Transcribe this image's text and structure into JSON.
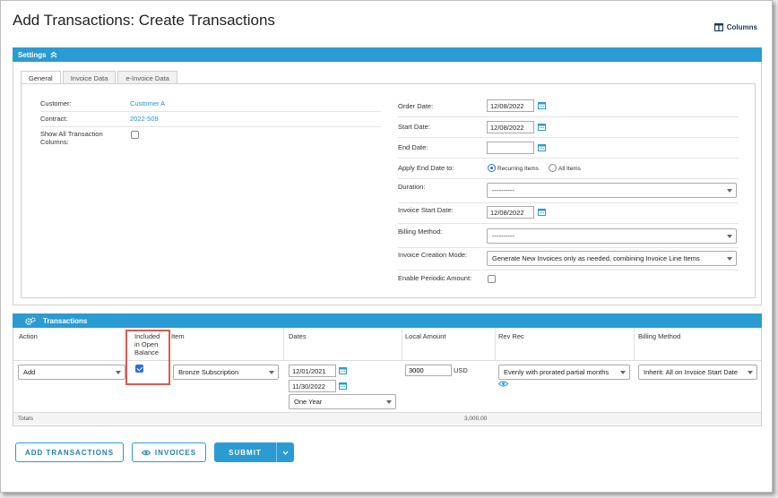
{
  "page": {
    "title": "Add Transactions: Create Transactions"
  },
  "toolbar": {
    "columns_label": "Columns"
  },
  "settings": {
    "header": "Settings",
    "tabs": [
      "General",
      "Invoice Data",
      "e-Invoice Data"
    ],
    "customer_label": "Customer:",
    "customer_value": "Customer A",
    "contract_label": "Contract:",
    "contract_value": "2022-509",
    "show_all_label_1": "Show All Transaction",
    "show_all_label_2": "Columns:",
    "order_date_label": "Order Date:",
    "order_date": "12/08/2022",
    "start_date_label": "Start Date:",
    "start_date": "12/08/2022",
    "end_date_label": "End Date:",
    "end_date": "",
    "apply_end_label": "Apply End Date to:",
    "apply_end_options": [
      "Recurring Items",
      "All Items"
    ],
    "duration_label": "Duration:",
    "duration_value": "----------",
    "invoice_start_label": "Invoice Start Date:",
    "invoice_start": "12/08/2022",
    "billing_method_label": "Billing Method:",
    "billing_method_value": "----------",
    "creation_mode_label": "Invoice Creation Mode:",
    "creation_mode_value": "Generate New Invoices only as needed, combining Invoice Line Items",
    "periodic_label": "Enable Periodic Amount:"
  },
  "transactions": {
    "header": "Transactions",
    "columns": {
      "action": "Action",
      "included_1": "Included",
      "included_2": "in Open",
      "included_3": "Balance",
      "item": "Item",
      "dates": "Dates",
      "local_amount": "Local Amount",
      "rev_rec": "Rev Rec",
      "billing_method": "Billing Method"
    },
    "row": {
      "action": "Add",
      "included": true,
      "item": "Bronze Subscription",
      "date_start": "12/01/2021",
      "date_end": "11/30/2022",
      "term": "One Year",
      "amount": "3000",
      "currency": "USD",
      "rev_rec": "Evenly with prorated partial months",
      "billing_method": "Inherit: All on Invoice Start Date"
    },
    "totals_label": "Totals",
    "totals_value": "3,000.00"
  },
  "buttons": {
    "add_transactions": "ADD TRANSACTIONS",
    "invoices": "INVOICES",
    "submit": "SUBMIT"
  },
  "colors": {
    "accent": "#2b9bd3",
    "link": "#2a90c8",
    "highlight": "#e05a4d"
  }
}
